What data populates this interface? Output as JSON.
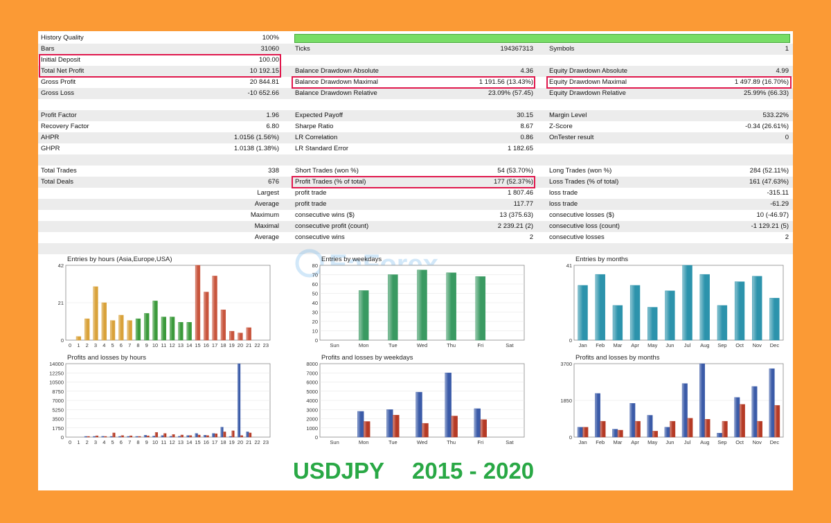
{
  "colors": {
    "background": "#fb9a35",
    "highlight": "#e0174c",
    "footer_text": "#29a845",
    "bar_green": "#77dd66"
  },
  "stats": {
    "history_quality": {
      "label": "History Quality",
      "value": "100%"
    },
    "bars": {
      "label": "Bars",
      "value": "31060"
    },
    "ticks": {
      "label": "Ticks",
      "value": "194367313"
    },
    "symbols": {
      "label": "Symbols",
      "value": "1"
    },
    "initial_deposit": {
      "label": "Initial Deposit",
      "value": "100.00"
    },
    "total_net_profit": {
      "label": "Total Net Profit",
      "value": "10 192.15"
    },
    "gross_profit": {
      "label": "Gross Profit",
      "value": "20 844.81"
    },
    "gross_loss": {
      "label": "Gross Loss",
      "value": "-10 652.66"
    },
    "balance_dd_abs": {
      "label": "Balance Drawdown Absolute",
      "value": "4.36"
    },
    "balance_dd_max": {
      "label": "Balance Drawdown Maximal",
      "value": "1 191.56 (13.43%)"
    },
    "balance_dd_rel": {
      "label": "Balance Drawdown Relative",
      "value": "23.09% (57.45)"
    },
    "equity_dd_abs": {
      "label": "Equity Drawdown Absolute",
      "value": "4.99"
    },
    "equity_dd_max": {
      "label": "Equity Drawdown Maximal",
      "value": "1 497.89 (16.70%)"
    },
    "equity_dd_rel": {
      "label": "Equity Drawdown Relative",
      "value": "25.99% (66.33)"
    },
    "profit_factor": {
      "label": "Profit Factor",
      "value": "1.96"
    },
    "recovery_factor": {
      "label": "Recovery Factor",
      "value": "6.80"
    },
    "ahpr": {
      "label": "AHPR",
      "value": "1.0156 (1.56%)"
    },
    "ghpr": {
      "label": "GHPR",
      "value": "1.0138 (1.38%)"
    },
    "expected_payoff": {
      "label": "Expected Payoff",
      "value": "30.15"
    },
    "sharpe_ratio": {
      "label": "Sharpe Ratio",
      "value": "8.67"
    },
    "lr_correlation": {
      "label": "LR Correlation",
      "value": "0.86"
    },
    "lr_std_error": {
      "label": "LR Standard Error",
      "value": "1 182.65"
    },
    "margin_level": {
      "label": "Margin Level",
      "value": "533.22%"
    },
    "z_score": {
      "label": "Z-Score",
      "value": "-0.34 (26.61%)"
    },
    "ontester": {
      "label": "OnTester result",
      "value": "0"
    },
    "total_trades": {
      "label": "Total Trades",
      "value": "338"
    },
    "total_deals": {
      "label": "Total Deals",
      "value": "676"
    },
    "short_trades": {
      "label": "Short Trades (won %)",
      "value": "54 (53.70%)"
    },
    "profit_trades": {
      "label": "Profit Trades (% of total)",
      "value": "177 (52.37%)"
    },
    "long_trades": {
      "label": "Long Trades (won %)",
      "value": "284 (52.11%)"
    },
    "loss_trades": {
      "label": "Loss Trades (% of total)",
      "value": "161 (47.63%)"
    },
    "largest": {
      "label": "Largest",
      "c2": "profit trade",
      "v2": "1 807.46",
      "c3": "loss trade",
      "v3": "-315.11"
    },
    "average": {
      "label": "Average",
      "c2": "profit trade",
      "v2": "117.77",
      "c3": "loss trade",
      "v3": "-61.29"
    },
    "maximum": {
      "label": "Maximum",
      "c2": "consecutive wins ($)",
      "v2": "13 (375.63)",
      "c3": "consecutive losses ($)",
      "v3": "10 (-46.97)"
    },
    "maximal": {
      "label": "Maximal",
      "c2": "consecutive profit (count)",
      "v2": "2 239.21 (2)",
      "c3": "consecutive loss (count)",
      "v3": "-1 129.21 (5)"
    },
    "average2": {
      "label": "Average",
      "c2": "consecutive wins",
      "v2": "2",
      "c3": "consecutive losses",
      "v3": "2"
    }
  },
  "watermark": "EaForex",
  "footer": {
    "symbol": "USDJPY",
    "years": "2015 - 2020"
  },
  "chart_data": [
    {
      "type": "bar",
      "title": "Entries by hours (Asia,Europe,USA)",
      "categories": [
        "0",
        "1",
        "2",
        "3",
        "4",
        "5",
        "6",
        "7",
        "8",
        "9",
        "10",
        "11",
        "12",
        "13",
        "14",
        "15",
        "16",
        "17",
        "18",
        "19",
        "20",
        "21",
        "22",
        "23"
      ],
      "values": [
        0,
        2,
        12,
        30,
        21,
        11,
        14,
        11,
        12,
        15,
        22,
        13,
        13,
        10,
        10,
        42,
        27,
        36,
        17,
        5,
        4,
        7,
        0,
        0
      ],
      "ylim": [
        0,
        42
      ],
      "yticks": [
        "0",
        "21",
        "42"
      ],
      "colors": [
        "#d9a23a",
        "#d9a23a",
        "#d9a23a",
        "#d9a23a",
        "#d9a23a",
        "#d9a23a",
        "#d9a23a",
        "#d9a23a",
        "#3b9a3b",
        "#3b9a3b",
        "#3b9a3b",
        "#3b9a3b",
        "#3b9a3b",
        "#3b9a3b",
        "#3b9a3b",
        "#c8553d",
        "#c8553d",
        "#c8553d",
        "#c8553d",
        "#c8553d",
        "#c8553d",
        "#c8553d",
        "#c8553d",
        "#c8553d"
      ]
    },
    {
      "type": "bar",
      "title": "Entries by weekdays",
      "categories": [
        "Sun",
        "Mon",
        "Tue",
        "Wed",
        "Thu",
        "Fri",
        "Sat"
      ],
      "values": [
        0,
        53,
        70,
        75,
        72,
        68,
        0
      ],
      "ylim": [
        0,
        80
      ],
      "yticks": [
        "0",
        "10",
        "20",
        "30",
        "40",
        "50",
        "60",
        "70",
        "80"
      ],
      "colors": [
        "#3a9a62"
      ]
    },
    {
      "type": "bar",
      "title": "Entries by months",
      "categories": [
        "Jan",
        "Feb",
        "Mar",
        "Apr",
        "May",
        "Jun",
        "Jul",
        "Aug",
        "Sep",
        "Oct",
        "Nov",
        "Dec"
      ],
      "values": [
        30,
        36,
        19,
        30,
        18,
        27,
        41,
        36,
        19,
        32,
        35,
        23
      ],
      "ylim": [
        0,
        41
      ],
      "yticks": [
        "0",
        "41"
      ],
      "colors": [
        "#2c93ac"
      ]
    },
    {
      "type": "bar",
      "title": "Profits and losses by hours",
      "categories": [
        "0",
        "1",
        "2",
        "3",
        "4",
        "5",
        "6",
        "7",
        "8",
        "9",
        "10",
        "11",
        "12",
        "13",
        "14",
        "15",
        "16",
        "17",
        "18",
        "19",
        "20",
        "21",
        "22",
        "23"
      ],
      "series": [
        {
          "values": [
            0,
            0,
            20,
            120,
            150,
            60,
            60,
            80,
            40,
            350,
            200,
            300,
            150,
            150,
            300,
            700,
            350,
            700,
            1900,
            30,
            14000,
            1000,
            0,
            0
          ]
        },
        {
          "values": [
            0,
            0,
            30,
            250,
            130,
            800,
            300,
            250,
            100,
            250,
            900,
            700,
            500,
            400,
            300,
            400,
            300,
            650,
            1000,
            1200,
            300,
            800,
            0,
            0
          ]
        }
      ],
      "ylim": [
        0,
        14000
      ],
      "yticks": [
        "0",
        "1750",
        "3500",
        "5250",
        "7000",
        "8750",
        "10500",
        "12250",
        "14000"
      ],
      "colors": [
        "#3b5ba8",
        "#b53a25"
      ]
    },
    {
      "type": "bar",
      "title": "Profits and losses by weekdays",
      "categories": [
        "Sun",
        "Mon",
        "Tue",
        "Wed",
        "Thu",
        "Fri",
        "Sat"
      ],
      "series": [
        {
          "values": [
            0,
            2800,
            3000,
            4900,
            7000,
            3100,
            0
          ]
        },
        {
          "values": [
            0,
            1700,
            2400,
            1500,
            2300,
            1900,
            0
          ]
        }
      ],
      "ylim": [
        0,
        8000
      ],
      "yticks": [
        "0",
        "1000",
        "2000",
        "3000",
        "4000",
        "5000",
        "6000",
        "7000",
        "8000"
      ],
      "colors": [
        "#3b5ba8",
        "#b53a25"
      ]
    },
    {
      "type": "bar",
      "title": "Profits and losses by months",
      "categories": [
        "Jan",
        "Feb",
        "Mar",
        "Apr",
        "May",
        "Jun",
        "Jul",
        "Aug",
        "Sep",
        "Oct",
        "Nov",
        "Dec"
      ],
      "series": [
        {
          "values": [
            500,
            2200,
            400,
            1700,
            1100,
            500,
            2700,
            3700,
            200,
            2000,
            2550,
            3450
          ]
        },
        {
          "values": [
            500,
            800,
            350,
            800,
            300,
            800,
            950,
            900,
            800,
            1650,
            800,
            1600
          ]
        }
      ],
      "ylim": [
        0,
        3700
      ],
      "yticks": [
        "0",
        "1850",
        "3700"
      ],
      "colors": [
        "#3b5ba8",
        "#b53a25"
      ]
    }
  ]
}
